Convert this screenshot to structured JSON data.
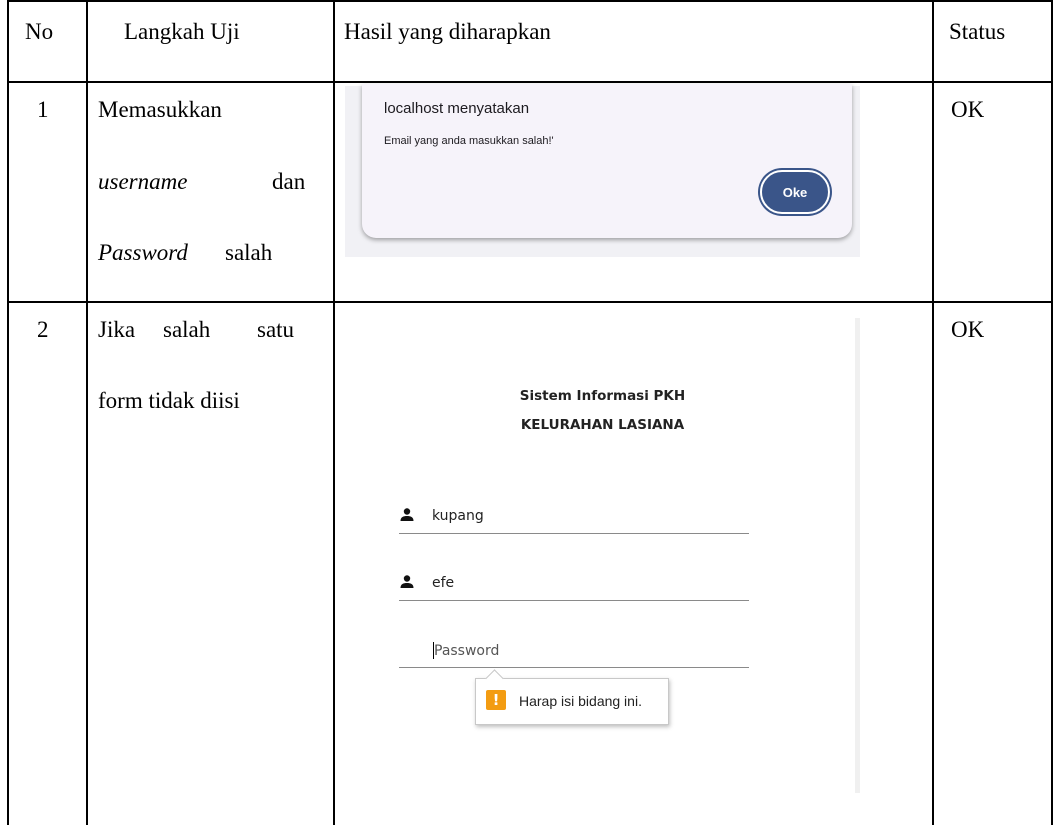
{
  "table": {
    "headers": {
      "no": "No",
      "step": "Langkah Uji",
      "expected": "Hasil yang diharapkan",
      "status": "Status"
    },
    "rows": [
      {
        "no": "1",
        "step_lines": [
          "Memasukkan",
          "username",
          "dan",
          "Password",
          "salah"
        ],
        "status": "OK",
        "screenshot": {
          "dialog_title": "localhost menyatakan",
          "dialog_message": "Email yang anda masukkan salah!'",
          "button_label": "Oke",
          "button_color": "#3a5589"
        }
      },
      {
        "no": "2",
        "step_lines": [
          "Jika",
          "salah",
          "satu",
          "form tidak diisi"
        ],
        "status": "OK",
        "screenshot": {
          "title_line1": "Sistem Informasi PKH",
          "title_line2": "KELURAHAN LASIANA",
          "field1_value": "kupang",
          "field2_value": "efe",
          "password_placeholder": "Password",
          "tooltip_text": "Harap isi bidang ini.",
          "warning_color": "#f39c12",
          "icons": [
            "user-icon",
            "user-icon",
            "warning-icon"
          ]
        }
      }
    ]
  }
}
